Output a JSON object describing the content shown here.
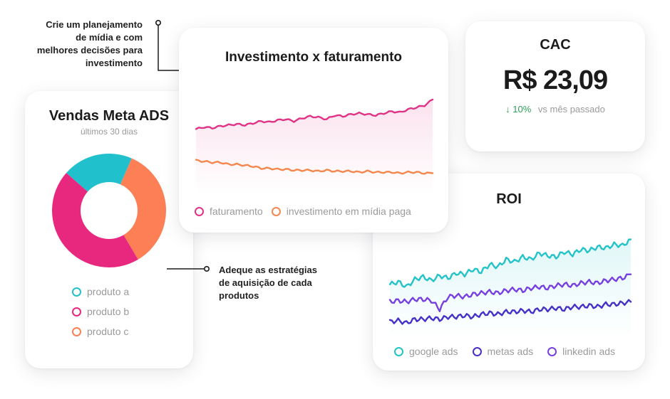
{
  "annotations": {
    "top_left": [
      "Crie um planejamento",
      "de mídia e com",
      "melhores decisões para",
      "investimento"
    ],
    "middle": [
      "Adeque as estratégias",
      "de aquisição de cada",
      "produtos"
    ]
  },
  "vendas": {
    "title": "Vendas Meta ADS",
    "subtitle": "últimos 30 dias",
    "legend": [
      {
        "label": "produto a",
        "color": "#20c1cc"
      },
      {
        "label": "produto b",
        "color": "#e8287f"
      },
      {
        "label": "produto c",
        "color": "#fd7f55"
      }
    ]
  },
  "investimento": {
    "title": "Investimento x faturamento",
    "legend": [
      {
        "label": "faturamento",
        "color": "#e03386"
      },
      {
        "label": "investimento em mídia paga",
        "color": "#f4874e"
      }
    ]
  },
  "cac": {
    "title": "CAC",
    "value": "R$ 23,09",
    "change": "10%",
    "change_icon": "arrow-down-icon",
    "comparison": "vs mês passado",
    "change_color": "#2e9c5a"
  },
  "roi": {
    "title": "ROI",
    "legend": [
      {
        "label": "google ads",
        "color": "#24c3c8"
      },
      {
        "label": "metas ads",
        "color": "#4530c8"
      },
      {
        "label": "linkedin ads",
        "color": "#7740e0"
      }
    ]
  },
  "chart_data": [
    {
      "type": "pie",
      "title": "Vendas Meta ADS",
      "categories": [
        "produto a",
        "produto b",
        "produto c"
      ],
      "values": [
        20,
        45,
        35
      ],
      "colors": [
        "#20c1cc",
        "#e8287f",
        "#fd7f55"
      ],
      "donut": true
    },
    {
      "type": "line",
      "title": "Investimento x faturamento",
      "x": [
        1,
        2,
        3,
        4,
        5,
        6,
        7,
        8,
        9,
        10,
        11,
        12,
        13,
        14,
        15,
        16,
        17,
        18,
        19,
        20,
        21,
        22,
        23,
        24,
        25,
        26,
        27,
        28,
        29,
        30
      ],
      "series": [
        {
          "name": "faturamento",
          "values": [
            62,
            64,
            63,
            65,
            66,
            67,
            66,
            68,
            70,
            69,
            71,
            72,
            70,
            73,
            75,
            74,
            72,
            76,
            75,
            77,
            78,
            77,
            76,
            78,
            80,
            79,
            82,
            84,
            86,
            92
          ],
          "color": "#e03386"
        },
        {
          "name": "investimento em mídia paga",
          "values": [
            30,
            29,
            28,
            28,
            26,
            26,
            25,
            24,
            22,
            22,
            21,
            21,
            20,
            20,
            20,
            19,
            20,
            19,
            19,
            19,
            18,
            19,
            18,
            18,
            18,
            17,
            18,
            18,
            17,
            17
          ],
          "color": "#f4874e"
        }
      ],
      "ylim": [
        0,
        100
      ],
      "legend_position": "bottom-left"
    },
    {
      "type": "line",
      "title": "ROI",
      "x": [
        1,
        2,
        3,
        4,
        5,
        6,
        7,
        8,
        9,
        10,
        11,
        12,
        13,
        14,
        15,
        16,
        17,
        18,
        19,
        20,
        21,
        22,
        23,
        24,
        25,
        26,
        27,
        28,
        29,
        30
      ],
      "series": [
        {
          "name": "google ads",
          "values": [
            40,
            42,
            38,
            44,
            46,
            43,
            47,
            45,
            49,
            48,
            52,
            50,
            56,
            54,
            60,
            58,
            62,
            60,
            65,
            63,
            62,
            66,
            64,
            68,
            67,
            70,
            69,
            72,
            71,
            76
          ],
          "color": "#24c3c8"
        },
        {
          "name": "metas ads",
          "values": [
            10,
            11,
            9,
            12,
            12,
            13,
            12,
            14,
            14,
            15,
            14,
            16,
            17,
            16,
            18,
            18,
            19,
            18,
            20,
            20,
            21,
            20,
            22,
            22,
            23,
            22,
            24,
            24,
            25,
            26
          ],
          "color": "#4530c8"
        },
        {
          "name": "linkedin ads",
          "values": [
            26,
            27,
            26,
            28,
            28,
            27,
            20,
            30,
            31,
            30,
            32,
            33,
            34,
            33,
            35,
            36,
            35,
            37,
            38,
            37,
            39,
            40,
            39,
            41,
            42,
            41,
            43,
            44,
            45,
            48
          ],
          "color": "#7740e0"
        }
      ],
      "ylim": [
        0,
        90
      ],
      "legend_position": "bottom"
    }
  ]
}
